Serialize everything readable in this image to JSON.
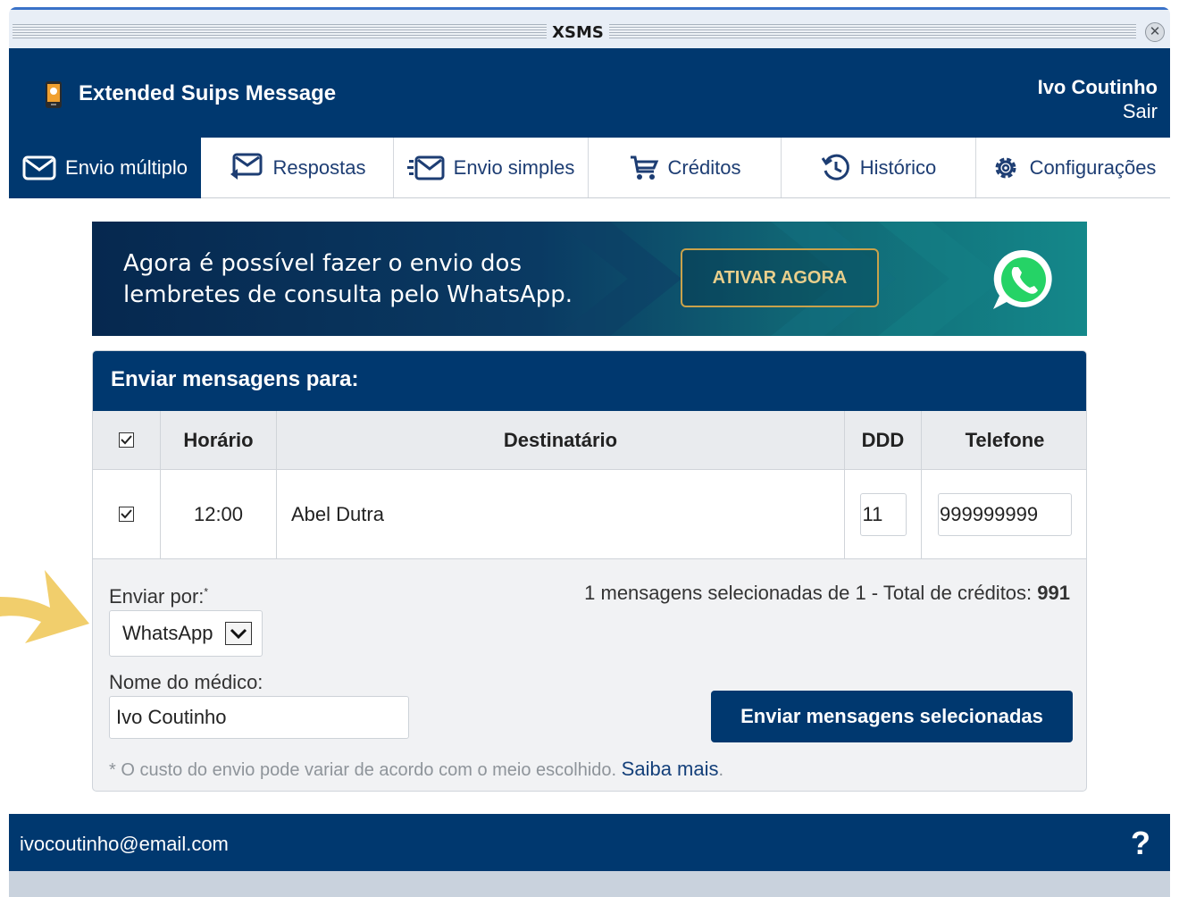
{
  "window": {
    "title": "XSMS",
    "close_icon": "close-icon"
  },
  "header": {
    "app_name": "Extended Suips Message",
    "user_name": "Ivo Coutinho",
    "logout": "Sair"
  },
  "tabs": [
    {
      "label": "Envio múltiplo",
      "icon": "envelope-icon",
      "active": true
    },
    {
      "label": "Respostas",
      "icon": "reply-envelope-icon",
      "active": false
    },
    {
      "label": "Envio simples",
      "icon": "fast-envelope-icon",
      "active": false
    },
    {
      "label": "Créditos",
      "icon": "cart-icon",
      "active": false
    },
    {
      "label": "Histórico",
      "icon": "history-icon",
      "active": false
    },
    {
      "label": "Configurações",
      "icon": "gear-icon",
      "active": false
    }
  ],
  "banner": {
    "text_line1": "Agora é possível fazer o envio dos",
    "text_line2": "lembretes de consulta pelo WhatsApp.",
    "button": "ATIVAR AGORA",
    "icon": "whatsapp-icon"
  },
  "panel": {
    "title": "Enviar mensagens para:",
    "columns": [
      "Horário",
      "Destinatário",
      "DDD",
      "Telefone"
    ],
    "header_checked": true,
    "rows": [
      {
        "checked": true,
        "time": "12:00",
        "recipient": "Abel Dutra",
        "ddd": "11",
        "phone": "999999999"
      }
    ],
    "send_by_label": "Enviar por:",
    "send_by_required": "*",
    "send_by_value": "WhatsApp",
    "summary_prefix": "1 mensagens selecionadas de 1 - Total de créditos:",
    "summary_credits": "991",
    "doctor_label": "Nome do médico:",
    "doctor_value": "Ivo Coutinho",
    "send_button": "Enviar mensagens selecionadas",
    "note_text": "* O custo do envio pode variar de acordo com o meio escolhido.",
    "note_link": "Saiba mais",
    "note_end": "."
  },
  "footer": {
    "email": "ivocoutinho@email.com",
    "help": "?"
  },
  "colors": {
    "navy": "#00386f",
    "gold": "#c9a24b",
    "whatsapp_green": "#25d366",
    "arrow_yellow": "#f0c95c"
  }
}
